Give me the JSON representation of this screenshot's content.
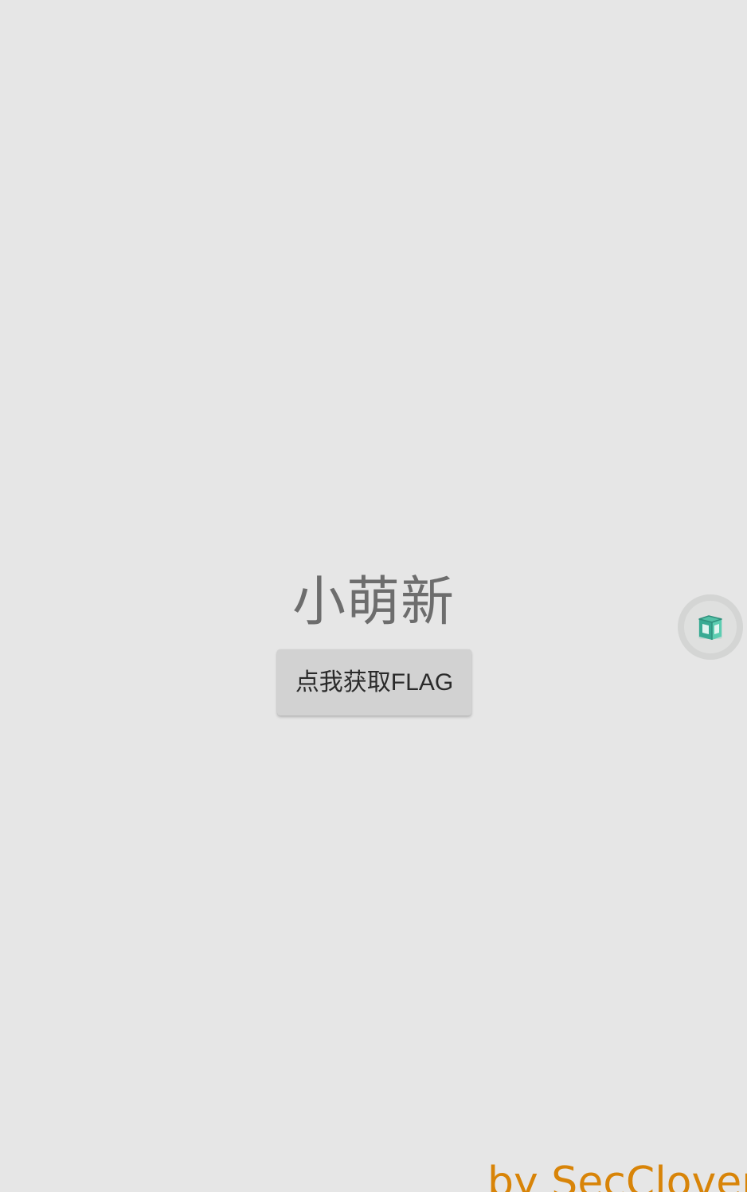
{
  "screen": {
    "title": "小萌新",
    "button_label": "点我获取FLAG",
    "signature": "by SecClover"
  },
  "icons": {
    "floating_tool": "cube-icon"
  },
  "colors": {
    "background": "#e6e6e6",
    "title_text": "#6d6d6d",
    "button_background": "#d2d2d2",
    "button_text": "#2a2a2a",
    "signature_text": "#d88408",
    "icon_accent": "#4fbfa4"
  }
}
